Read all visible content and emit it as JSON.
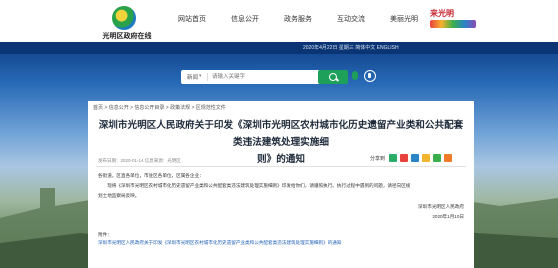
{
  "header": {
    "logo_text": "光明区政府在线",
    "nav": [
      "网站首页",
      "信息公开",
      "政务服务",
      "互动交流",
      "美丽光明"
    ],
    "brand_text": "来光明"
  },
  "top_bar": {
    "date_text": "2020年4月22日 星期三    简体中文    ENGLISH"
  },
  "search": {
    "scope_label": "新闻",
    "placeholder": "请输入关键字"
  },
  "article": {
    "breadcrumb": "首页 > 信息公开 > 信息公开目录 > 政策法规 > 区规范性文件",
    "title_line1": "深圳市光明区人民政府关于印发《深圳市光明区农村城市化历史遗留产业类和公共配套类违法建筑处理实施细",
    "title_line2": "则》的通知",
    "meta": "发布日期：2020-01-14    信息来源：光明区",
    "share_label": "分享到",
    "paragraph1": "各街道，区直各单位，市驻区各单位，区属各企业：",
    "paragraph2": "　　现将《深圳市光明区农村城市化历史遗留产业类和公共配套类违法建筑处理实施细则》印发给你们，请遵照执行。执行过程中遇到的问题，请径向区规",
    "paragraph3": "划土地监察局反映。",
    "signature": "深圳市光明区人民政府",
    "date": "2020年1月10日",
    "attachment_label": "附件：",
    "attachment_link": "深圳市光明区人民政府关于印发《深圳市光明区农村城市化历史遗留产业类和公共配套类违法建筑处理实施细则》的通知"
  },
  "colors": {
    "accent_green": "#1fa05a",
    "title_color": "#1e2a3a",
    "link_blue": "#1f5fb5",
    "banner_top": "#0e3f86"
  },
  "icons": {
    "share": [
      "wechat-icon",
      "weibo-icon",
      "qq-icon",
      "qzone-icon",
      "douban-icon",
      "more-icon"
    ]
  }
}
